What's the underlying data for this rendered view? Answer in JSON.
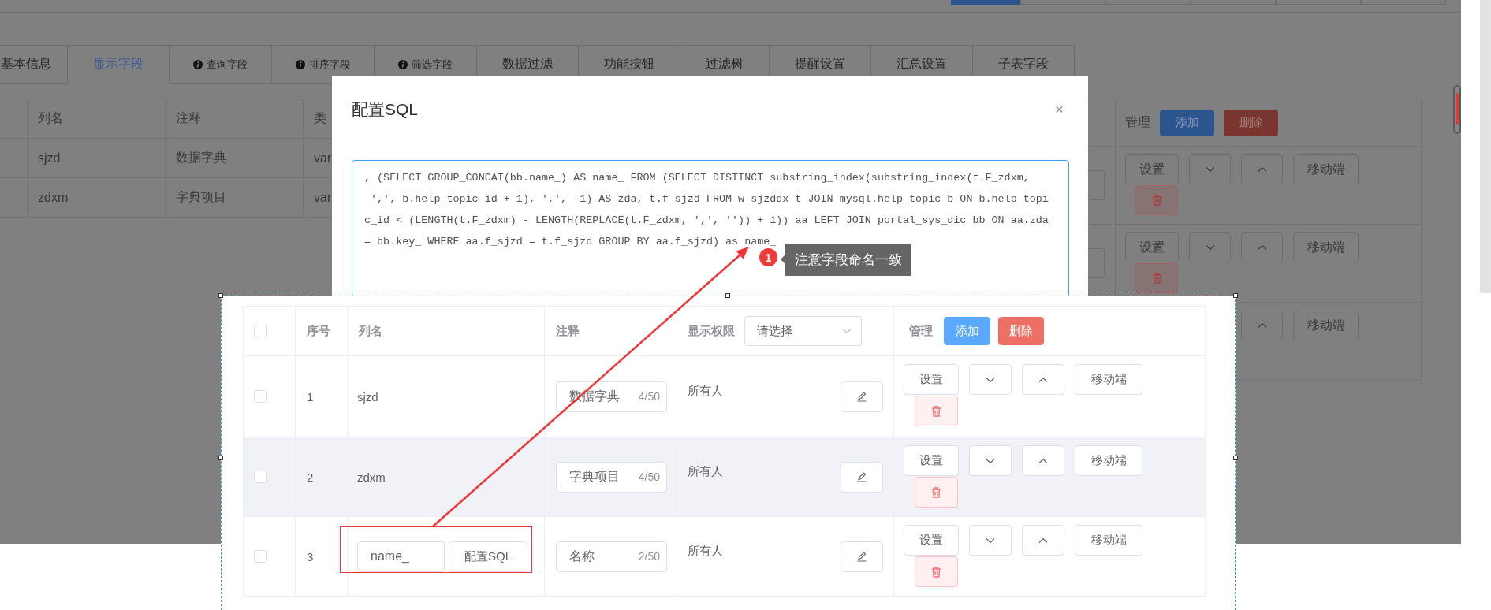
{
  "background_page": {
    "tabs": [
      {
        "label": "基本信息",
        "kind": "plain",
        "selected": false
      },
      {
        "label": "显示字段",
        "kind": "plain",
        "selected": true
      },
      {
        "label": "查询字段",
        "kind": "info",
        "selected": false
      },
      {
        "label": "排序字段",
        "kind": "info",
        "selected": false
      },
      {
        "label": "筛选字段",
        "kind": "info",
        "selected": false
      },
      {
        "label": "数据过滤",
        "kind": "plain",
        "selected": false
      },
      {
        "label": "功能按钮",
        "kind": "plain",
        "selected": false
      },
      {
        "label": "过滤树",
        "kind": "plain",
        "selected": false
      },
      {
        "label": "提醒设置",
        "kind": "plain",
        "selected": false
      },
      {
        "label": "汇总设置",
        "kind": "plain",
        "selected": false
      },
      {
        "label": "子表字段",
        "kind": "plain",
        "selected": false
      }
    ],
    "field_table": {
      "columns": [
        "列名",
        "注释",
        "类"
      ],
      "rows": [
        {
          "name": "sjzd",
          "comment": "数据字典",
          "type": "var"
        },
        {
          "name": "zdxm",
          "comment": "字典项目",
          "type": "var"
        }
      ]
    },
    "manage_column": {
      "header": "管理",
      "add_button": "添加",
      "delete_button": "删除",
      "rows": [
        {
          "kind": "full",
          "settings_button": "设置",
          "mobile_button": "移动端"
        },
        {
          "kind": "full",
          "settings_button": "设置",
          "mobile_button": "移动端"
        },
        {
          "kind": "covered",
          "mobile_button": "移动端"
        }
      ]
    }
  },
  "dialog": {
    "title": "配置SQL",
    "close": "×",
    "sql_lines": [
      ", (SELECT GROUP_CONCAT(bb.name_) AS name_ FROM (SELECT DISTINCT substring_index(substring_index(t.F_zdxm,",
      " ',', b.help_topic_id + 1), ',', -1) AS zda, t.f_sjzd FROM w_sjzddx t JOIN mysql.help_topic b ON b.help_topi",
      "c_id < (LENGTH(t.F_zdxm) - LENGTH(REPLACE(t.F_zdxm, ',', '')) + 1)) aa LEFT JOIN portal_sys_dic bb ON aa.zda",
      "= bb.key_ WHERE aa.f_sjzd = t.f_sjzd GROUP BY aa.f_sjzd) as name_"
    ]
  },
  "capture": {
    "header_checked": false,
    "columns": {
      "index": "序号",
      "name": "列名",
      "comment": "注释",
      "permission": "显示权限",
      "manage": "管理"
    },
    "permission_filter": {
      "placeholder": "请选择"
    },
    "add_button": "添加",
    "delete_button": "删除",
    "rows": [
      {
        "index": "1",
        "checked": false,
        "highlighted": false,
        "name": {
          "kind": "text",
          "value": "sjzd"
        },
        "comment": "数据字典",
        "comment_count": "4/50",
        "permission": "所有人",
        "settings_button": "设置",
        "mobile_button": "移动端"
      },
      {
        "index": "2",
        "checked": false,
        "highlighted": true,
        "name": {
          "kind": "text",
          "value": "zdxm"
        },
        "comment": "字典项目",
        "comment_count": "4/50",
        "permission": "所有人",
        "settings_button": "设置",
        "mobile_button": "移动端"
      },
      {
        "index": "3",
        "checked": false,
        "highlighted": false,
        "name": {
          "kind": "input",
          "value": "name_",
          "button": "配置SQL"
        },
        "comment": "名称",
        "comment_count": "2/50",
        "permission": "所有人",
        "settings_button": "设置",
        "mobile_button": "移动端"
      }
    ]
  },
  "annotation": {
    "number": "1",
    "note": "注意字段命名一致"
  }
}
